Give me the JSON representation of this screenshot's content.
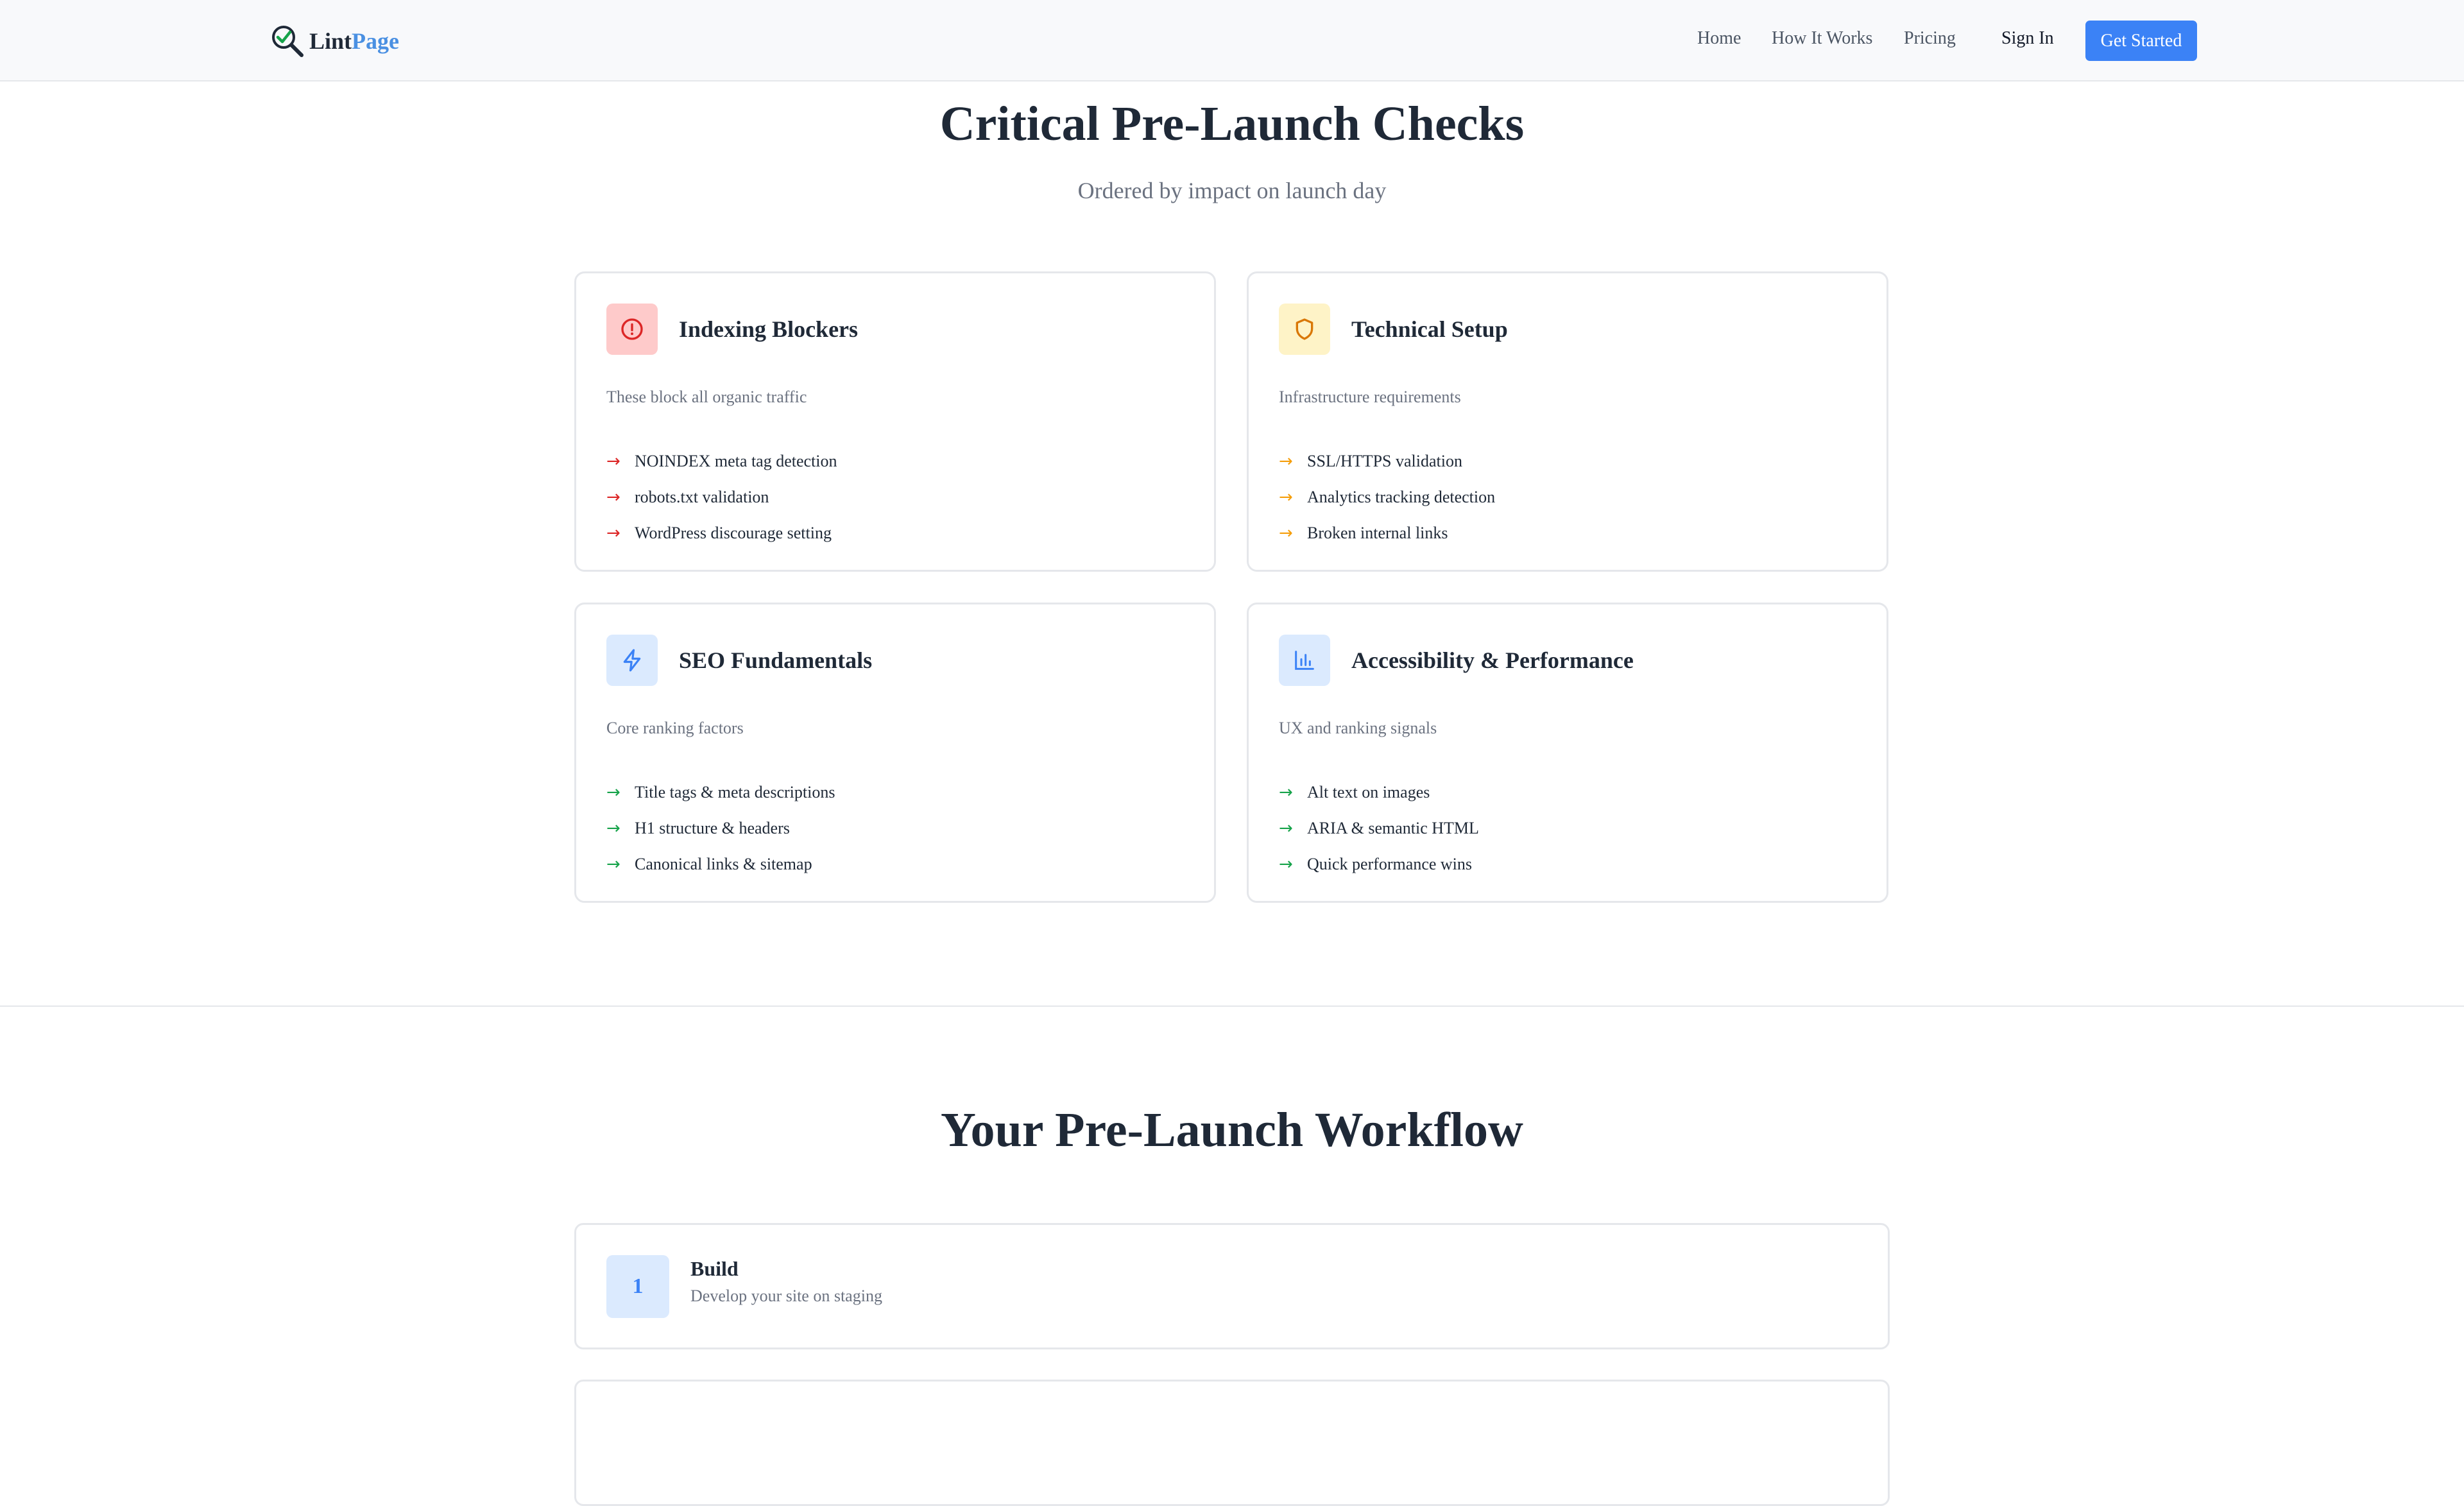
{
  "nav": {
    "logo_part1": "Lint",
    "logo_part2": "Page",
    "links": [
      "Home",
      "How It Works",
      "Pricing"
    ],
    "sign_in": "Sign In",
    "cta": "Get Started"
  },
  "checks": {
    "title": "Critical Pre-Launch Checks",
    "subtitle": "Ordered by impact on launch day",
    "cards": [
      {
        "icon": "alert-circle-icon",
        "accent": "#dc2626",
        "icon_bg": "#fecaca",
        "title": "Indexing Blockers",
        "desc": "These block all organic traffic",
        "items": [
          "NOINDEX meta tag detection",
          "robots.txt validation",
          "WordPress discourage setting"
        ]
      },
      {
        "icon": "shield-icon",
        "accent": "#f59e0b",
        "icon_bg": "#fef3c7",
        "title": "Technical Setup",
        "desc": "Infrastructure requirements",
        "items": [
          "SSL/HTTPS validation",
          "Analytics tracking detection",
          "Broken internal links"
        ]
      },
      {
        "icon": "lightning-icon",
        "accent": "#16a34a",
        "icon_bg": "#dbeafe",
        "title": "SEO Fundamentals",
        "desc": "Core ranking factors",
        "items": [
          "Title tags & meta descriptions",
          "H1 structure & headers",
          "Canonical links & sitemap"
        ]
      },
      {
        "icon": "bar-chart-icon",
        "accent": "#16a34a",
        "icon_bg": "#dbeafe",
        "title": "Accessibility & Performance",
        "desc": "UX and ranking signals",
        "items": [
          "Alt text on images",
          "ARIA & semantic HTML",
          "Quick performance wins"
        ]
      }
    ]
  },
  "workflow": {
    "title": "Your Pre-Launch Workflow",
    "steps": [
      {
        "number": "1",
        "title": "Build",
        "desc": "Develop your site on staging"
      }
    ]
  },
  "colors": {
    "brand": "#3b82f6",
    "logo_accent": "#4a90e2"
  }
}
